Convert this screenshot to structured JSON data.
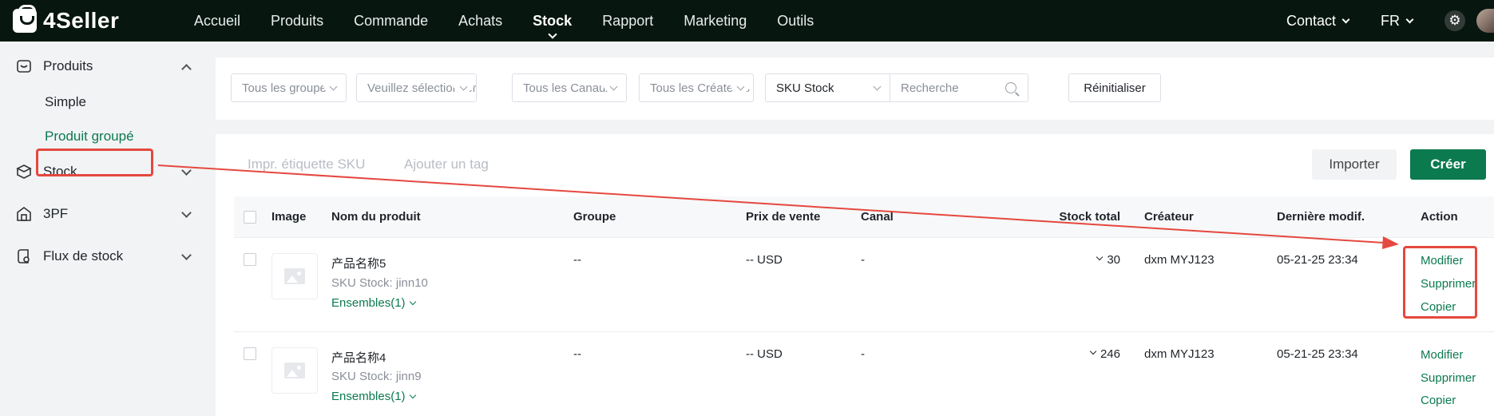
{
  "brand": {
    "name": "4Seller",
    "accent": "#0b7a4f",
    "topbar_bg": "#07170f",
    "annotation_color": "#e5483f"
  },
  "nav": {
    "items": [
      {
        "label": "Accueil"
      },
      {
        "label": "Produits"
      },
      {
        "label": "Commande"
      },
      {
        "label": "Achats"
      },
      {
        "label": "Stock"
      },
      {
        "label": "Rapport"
      },
      {
        "label": "Marketing"
      },
      {
        "label": "Outils"
      }
    ],
    "active": "Stock",
    "contact": "Contact",
    "language": "FR",
    "settings_icon": "gear-icon"
  },
  "sidebar": {
    "groups": [
      {
        "label": "Produits",
        "icon": "product-box-icon",
        "expanded": true
      },
      {
        "label": "Stock",
        "icon": "stock-icon",
        "expanded": false
      },
      {
        "label": "3PF",
        "icon": "warehouse-icon",
        "expanded": false
      },
      {
        "label": "Flux de stock",
        "icon": "stock-flow-icon",
        "expanded": false
      }
    ],
    "sub_items": [
      {
        "label": "Simple",
        "active": false
      },
      {
        "label": "Produit groupé",
        "active": true
      }
    ]
  },
  "filters": {
    "group": "Tous les groupes",
    "select": "Veuillez sélectionner",
    "channel": "Tous les Canaux",
    "creator": "Tous les Créateurs",
    "search_field": "SKU Stock",
    "search_placeholder": "Recherche",
    "reset_label": "Réinitialiser"
  },
  "toolbar": {
    "print_label": "Impr. étiquette SKU",
    "tag_label": "Ajouter un tag",
    "import_label": "Importer",
    "create_label": "Créer"
  },
  "table": {
    "headers": {
      "image": "Image",
      "name": "Nom du produit",
      "group": "Groupe",
      "price": "Prix de vente",
      "channel": "Canal",
      "stock": "Stock total",
      "creator": "Créateur",
      "modified": "Dernière modif.",
      "action": "Action"
    },
    "rows": [
      {
        "name": "产品名称5",
        "sku": "SKU Stock: jinn10",
        "bundles": "Ensembles(1)",
        "group": "--",
        "price": "-- USD",
        "channel": "-",
        "stock": "30",
        "creator": "dxm MYJ123",
        "modified": "05-21-25 23:34",
        "actions": [
          "Modifier",
          "Supprimer",
          "Copier"
        ]
      },
      {
        "name": "产品名称4",
        "sku": "SKU Stock: jinn9",
        "bundles": "Ensembles(1)",
        "group": "--",
        "price": "-- USD",
        "channel": "-",
        "stock": "246",
        "creator": "dxm MYJ123",
        "modified": "05-21-25 23:34",
        "actions": [
          "Modifier",
          "Supprimer",
          "Copier"
        ]
      }
    ]
  }
}
